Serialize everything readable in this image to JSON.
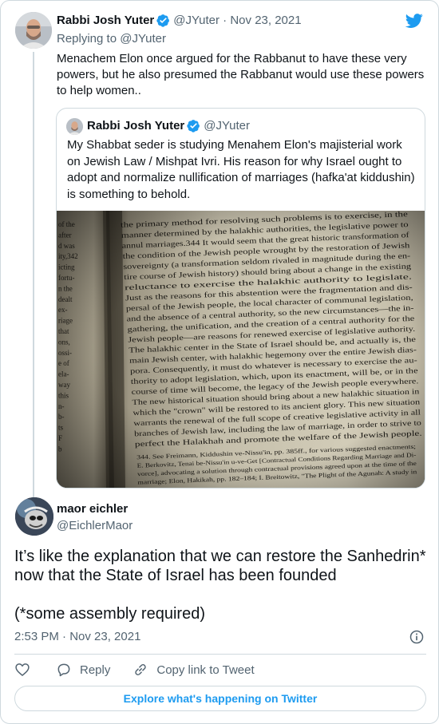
{
  "parent_tweet": {
    "author_name": "Rabbi Josh Yuter",
    "meta": "@JYuter · Nov 23, 2021",
    "replying_to": "Replying to @JYuter",
    "text": "Menachem Elon once argued for the Rabbanut to have these very powers, but he also presumed the Rabbanut would use these powers to help women.."
  },
  "quoted_tweet": {
    "author_name": "Rabbi Josh Yuter",
    "handle": "@JYuter",
    "text": "My Shabbat seder is  studying Menahem Elon's majisterial work on Jewish Law / Mishpat Ivri. His reason for why Israel ought to adopt and normalize nullification of marriages (hafka'at kiddushin) is something to behold.",
    "photo_lines": [
      "the primary method for resolving such problems is to exercise, in the",
      "manner determined by the halakhic authorities, the legislative power to",
      "annul marriages.344 It would seem that the great historic transformation of",
      "the condition of the Jewish people wrought by the restoration of Jewish",
      "sovereignty (a transformation seldom rivaled in magnitude during the en-",
      "tire course of Jewish history) should bring about a change in the existing",
      "reluctance to exercise the halakhic authority to legislate.",
      "Just as the reasons for this abstention were the fragmentation and dis-",
      "persal of the Jewish people, the local character of communal legislation,",
      "and the absence of a central authority, so the new circumstances—the in-",
      "gathering, the unification, and the creation of a central authority for the",
      "Jewish people—are reasons for renewed exercise of legislative authority.",
      "The halakhic center in the State of Israel should be, and actually is, the",
      "main Jewish center, with halakhic hegemony over the entire Jewish dias-",
      "pora. Consequently, it must do whatever is necessary to exercise the au-",
      "thority to adopt legislation, which, upon its enactment, will be, or in the",
      "course of time will become, the legacy of the Jewish people everywhere.",
      "The new historical situation should bring about a new halakhic situation in",
      "which the \"crown\" will be restored to its ancient glory. This new situation",
      "warrants the renewal of the full scope of creative legislative activity in all",
      "branches of Jewish law, including the law of marriage, in order to strive to",
      "perfect the Halakhah and promote the welfare of the Jewish people."
    ],
    "photo_footnote": [
      "344. See Freimann, Kiddushin ve-Nissu'in, pp. 385ff., for various suggested enactments;",
      "E. Berkovitz, Tenai be-Nissu'in u-ve-Get [Contractual Conditions Regarding Marriage and Di-",
      "vorce], advocating a solution through contractual provisions agreed upon at the time of the",
      "marriage; Elon, Hakikah, pp. 182–184; I. Breitowitz, \"The Plight of the Agunah: A study in"
    ],
    "photo_left_margin": [
      "of the",
      "after",
      "d was",
      "ity,342",
      "icting",
      "fortu-",
      "n the",
      "dealt",
      "ex-",
      "riage",
      "that",
      "ons,",
      "ossi-",
      "e of",
      "ela-",
      "way",
      "this",
      "n-",
      "b-",
      "ts",
      "F",
      "b"
    ]
  },
  "main_tweet": {
    "author_name": "maor eichler",
    "handle": "@EichlerMaor",
    "text_line1": "It’s like the explanation that we can restore the Sanhedrin* now that the State of Israel has been founded",
    "text_line2": "(*some assembly required)",
    "timestamp": "2:53 PM · Nov 23, 2021"
  },
  "actions": {
    "reply_label": "Reply",
    "copy_link_label": "Copy link to Tweet"
  },
  "explore_label": "Explore what's happening on Twitter",
  "colors": {
    "accent": "#1d9bf0",
    "text": "#0f1419",
    "muted": "#536471",
    "border": "#cfd9de"
  }
}
